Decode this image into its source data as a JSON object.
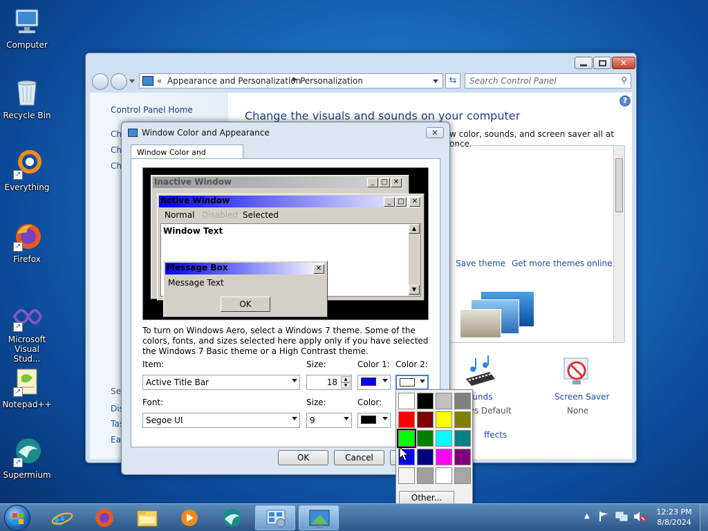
{
  "desktop": {
    "icons": [
      {
        "label": "Computer",
        "icon": "computer-icon"
      },
      {
        "label": "Recycle Bin",
        "icon": "recycle-bin-icon"
      },
      {
        "label": "Everything",
        "icon": "everything-icon"
      },
      {
        "label": "Firefox",
        "icon": "firefox-icon"
      },
      {
        "label": "Microsoft Visual Stud...",
        "icon": "visual-studio-icon"
      },
      {
        "label": "Notepad++",
        "icon": "notepad-plus-plus-icon"
      },
      {
        "label": "Supermium",
        "icon": "supermium-icon"
      }
    ]
  },
  "control_panel": {
    "breadcrumb_prefix": "«",
    "breadcrumb_1": "Appearance and Personalization",
    "breadcrumb_2": "Personalization",
    "search_placeholder": "Search Control Panel",
    "left_home": "Control Panel Home",
    "left_items": [
      "Ch",
      "Ch",
      "Ch"
    ],
    "see_also_title": "See",
    "see_also": [
      "Dis",
      "Tas",
      "Eas"
    ],
    "heading": "Change the visuals and sounds on your computer",
    "subheading": "w color, sounds, and screen saver all at once.",
    "save_theme": "Save theme",
    "get_more_themes": "Get more themes online",
    "sounds_label": "ounds",
    "sounds_value": "ws Default",
    "screen_saver_label": "Screen Saver",
    "screen_saver_value": "None",
    "effects_label": "ffects"
  },
  "dialog": {
    "title": "Window Color and Appearance",
    "tab": "Window Color and Appearance",
    "preview": {
      "inactive_title": "Inactive Window",
      "active_title": "Active Window",
      "menu_normal": "Normal",
      "menu_disabled": "Disabled",
      "menu_selected": "Selected",
      "window_text": "Window Text",
      "message_box_title": "Message Box",
      "message_text": "Message Text",
      "ok": "OK"
    },
    "info": "To turn on Windows Aero, select a Windows 7 theme.  Some of the colors, fonts, and sizes selected here apply only if you have selected the Windows 7 Basic theme or a High Contrast theme.",
    "item_label": "Item:",
    "item_value": "Active Title Bar",
    "size_label": "Size:",
    "size_value": "18",
    "color1_label": "Color 1:",
    "color1": "#0000ff",
    "color2_label": "Color 2:",
    "color2": "#ffffff",
    "font_label": "Font:",
    "font_value": "Segoe UI",
    "font_size_label": "Size:",
    "font_size_value": "9",
    "font_color_label": "Color:",
    "font_color": "#000000",
    "ok": "OK",
    "cancel": "Cancel"
  },
  "palette": {
    "colors": [
      "#ffffff",
      "#000000",
      "#c0c0c0",
      "#808080",
      "#ff0000",
      "#800000",
      "#ffff00",
      "#808000",
      "#00ff00",
      "#008000",
      "#00ffff",
      "#008080",
      "#0000ff",
      "#000080",
      "#ff00ff",
      "#800080",
      "#f4f4f4",
      "#a0a0a0",
      "#ffffff",
      "#a6a6a6"
    ],
    "selected_index": 8,
    "other": "Other..."
  },
  "taskbar": {
    "items": [
      "ie-icon",
      "firefox-icon",
      "explorer-icon",
      "media-player-icon",
      "supermium-icon",
      "control-panel-icon",
      "personalization-icon"
    ],
    "time": "12:23 PM",
    "date": "8/8/2024"
  }
}
